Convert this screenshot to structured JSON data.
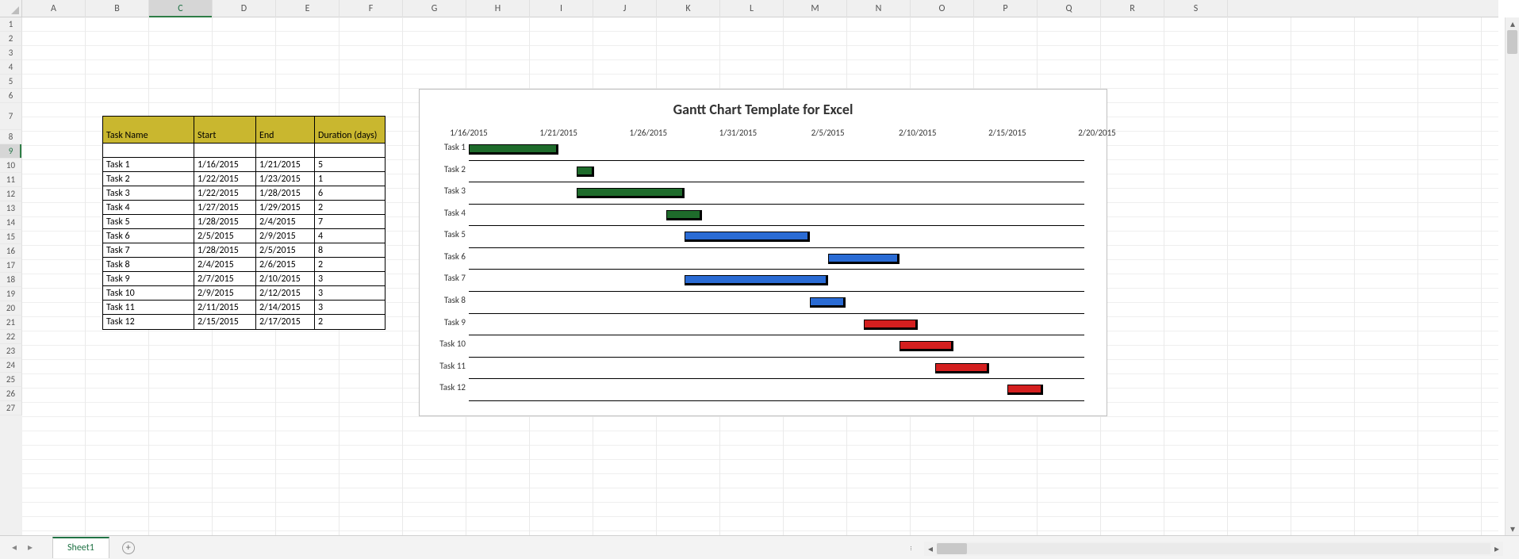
{
  "selected_column": "C",
  "selected_row": 9,
  "columns": [
    "A",
    "B",
    "C",
    "D",
    "E",
    "F",
    "G",
    "H",
    "I",
    "J",
    "K",
    "L",
    "M",
    "N",
    "O",
    "P",
    "Q",
    "R",
    "S"
  ],
  "row_numbers": [
    1,
    2,
    3,
    4,
    5,
    6,
    7,
    8,
    9,
    10,
    11,
    12,
    13,
    14,
    15,
    16,
    17,
    18,
    19,
    20,
    21,
    22,
    23,
    24,
    25,
    26,
    27
  ],
  "table": {
    "headers": {
      "task": "Task Name",
      "start": "Start",
      "end": "End",
      "duration": "Duration (days)"
    },
    "rows": [
      {
        "task": "Task 1",
        "start": "1/16/2015",
        "end": "1/21/2015",
        "duration": "5"
      },
      {
        "task": "Task 2",
        "start": "1/22/2015",
        "end": "1/23/2015",
        "duration": "1"
      },
      {
        "task": "Task 3",
        "start": "1/22/2015",
        "end": "1/28/2015",
        "duration": "6"
      },
      {
        "task": "Task 4",
        "start": "1/27/2015",
        "end": "1/29/2015",
        "duration": "2"
      },
      {
        "task": "Task 5",
        "start": "1/28/2015",
        "end": "2/4/2015",
        "duration": "7"
      },
      {
        "task": "Task 6",
        "start": "2/5/2015",
        "end": "2/9/2015",
        "duration": "4"
      },
      {
        "task": "Task 7",
        "start": "1/28/2015",
        "end": "2/5/2015",
        "duration": "8"
      },
      {
        "task": "Task 8",
        "start": "2/4/2015",
        "end": "2/6/2015",
        "duration": "2"
      },
      {
        "task": "Task 9",
        "start": "2/7/2015",
        "end": "2/10/2015",
        "duration": "3"
      },
      {
        "task": "Task 10",
        "start": "2/9/2015",
        "end": "2/12/2015",
        "duration": "3"
      },
      {
        "task": "Task 11",
        "start": "2/11/2015",
        "end": "2/14/2015",
        "duration": "3"
      },
      {
        "task": "Task 12",
        "start": "2/15/2015",
        "end": "2/17/2015",
        "duration": "2"
      }
    ]
  },
  "sheet_tab": "Sheet1",
  "chart_data": {
    "type": "bar",
    "title": "Gantt Chart Template for Excel",
    "x_ticks": [
      "1/16/2015",
      "1/21/2015",
      "1/26/2015",
      "1/31/2015",
      "2/5/2015",
      "2/10/2015",
      "2/15/2015",
      "2/20/2015"
    ],
    "x_range_start": "1/16/2015",
    "x_range_end": "2/20/2015",
    "x_range_days": 35,
    "series": [
      {
        "category": "Task 1",
        "start_offset_days": 0,
        "duration_days": 5,
        "color": "#1e6b2b"
      },
      {
        "category": "Task 2",
        "start_offset_days": 6,
        "duration_days": 1,
        "color": "#1e6b2b"
      },
      {
        "category": "Task 3",
        "start_offset_days": 6,
        "duration_days": 6,
        "color": "#1e6b2b"
      },
      {
        "category": "Task 4",
        "start_offset_days": 11,
        "duration_days": 2,
        "color": "#1e6b2b"
      },
      {
        "category": "Task 5",
        "start_offset_days": 12,
        "duration_days": 7,
        "color": "#2a6bd4"
      },
      {
        "category": "Task 6",
        "start_offset_days": 20,
        "duration_days": 4,
        "color": "#2a6bd4"
      },
      {
        "category": "Task 7",
        "start_offset_days": 12,
        "duration_days": 8,
        "color": "#2a6bd4"
      },
      {
        "category": "Task 8",
        "start_offset_days": 19,
        "duration_days": 2,
        "color": "#2a6bd4"
      },
      {
        "category": "Task 9",
        "start_offset_days": 22,
        "duration_days": 3,
        "color": "#d41f1f"
      },
      {
        "category": "Task 10",
        "start_offset_days": 24,
        "duration_days": 3,
        "color": "#d41f1f"
      },
      {
        "category": "Task 11",
        "start_offset_days": 26,
        "duration_days": 3,
        "color": "#d41f1f"
      },
      {
        "category": "Task 12",
        "start_offset_days": 30,
        "duration_days": 2,
        "color": "#d41f1f"
      }
    ]
  }
}
